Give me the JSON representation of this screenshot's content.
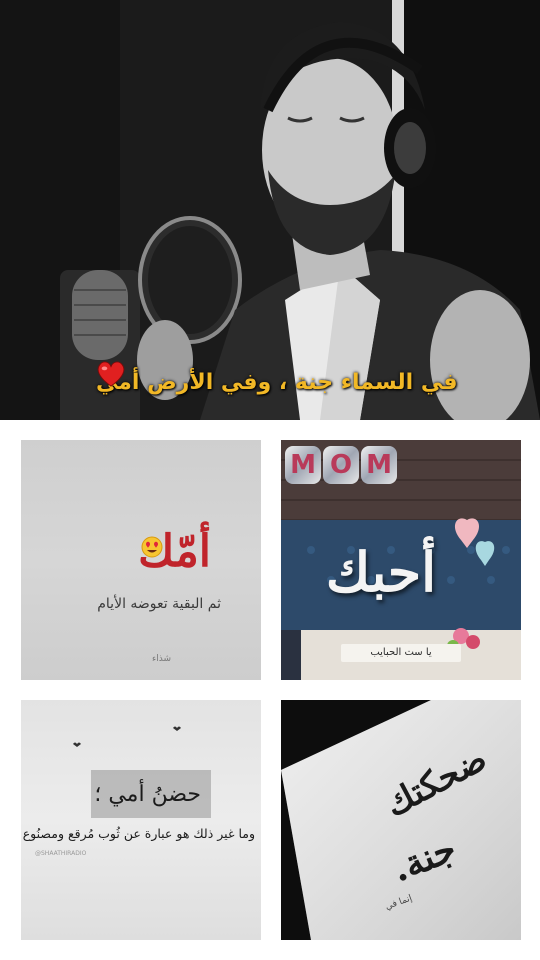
{
  "hero": {
    "caption": "في السماء جنة ، وفي الأرض أمي",
    "caption_color": "#f2b826",
    "emoji": "red-heart-icon"
  },
  "grid": {
    "tile1": {
      "title": "أمّك",
      "emoji": "heart-eyes-emoji-icon",
      "subtitle": "ثم البقية تعوضه الأيام",
      "signature": "شذاء"
    },
    "tile2": {
      "balloon_letters": [
        "M",
        "O",
        "M"
      ],
      "word": "أحبك",
      "plate_text": "يا ست الحبايب"
    },
    "tile3": {
      "title": "حضنُ أمي ؛",
      "body": "وما غير ذلك هو عبارة عن ثُوب مُرقع ومصنُوع في مصنع .",
      "credit": "@SHAATHIRADIO"
    },
    "tile4": {
      "line1": "ضحكتك",
      "line2": "جنة.",
      "signature": "إنما في"
    }
  }
}
